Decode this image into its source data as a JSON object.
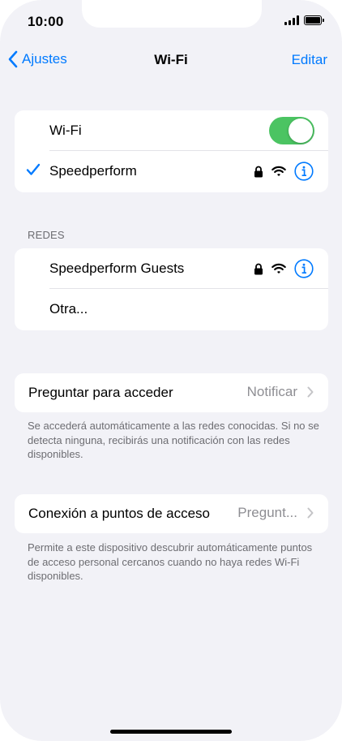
{
  "status_bar": {
    "time": "10:00"
  },
  "navbar": {
    "back_label": "Ajustes",
    "title": "Wi-Fi",
    "edit_label": "Editar"
  },
  "wifi_card": {
    "wifi_label": "Wi-Fi",
    "wifi_enabled": true,
    "connected_network": "Speedperform"
  },
  "networks": {
    "header": "REDES",
    "items": [
      {
        "name": "Speedperform Guests"
      },
      {
        "name": "Otra..."
      }
    ]
  },
  "ask_to_join": {
    "label": "Preguntar para acceder",
    "value": "Notificar",
    "footnote": "Se accederá automáticamente a las redes conocidas. Si no se detecta ninguna, recibirás una notificación con las redes disponibles."
  },
  "hotspot": {
    "label": "Conexión a puntos de acceso",
    "value": "Pregunt...",
    "footnote": "Permite a este dispositivo descubrir automáticamente puntos de acceso personal cercanos cuando no haya redes Wi-Fi disponibles."
  },
  "colors": {
    "accent": "#007aff",
    "toggle_on": "#4bc462",
    "background": "#f2f2f7"
  },
  "icons": [
    "chevron-left-icon",
    "checkmark-icon",
    "lock-icon",
    "wifi-icon",
    "info-icon",
    "chevron-right-icon"
  ]
}
